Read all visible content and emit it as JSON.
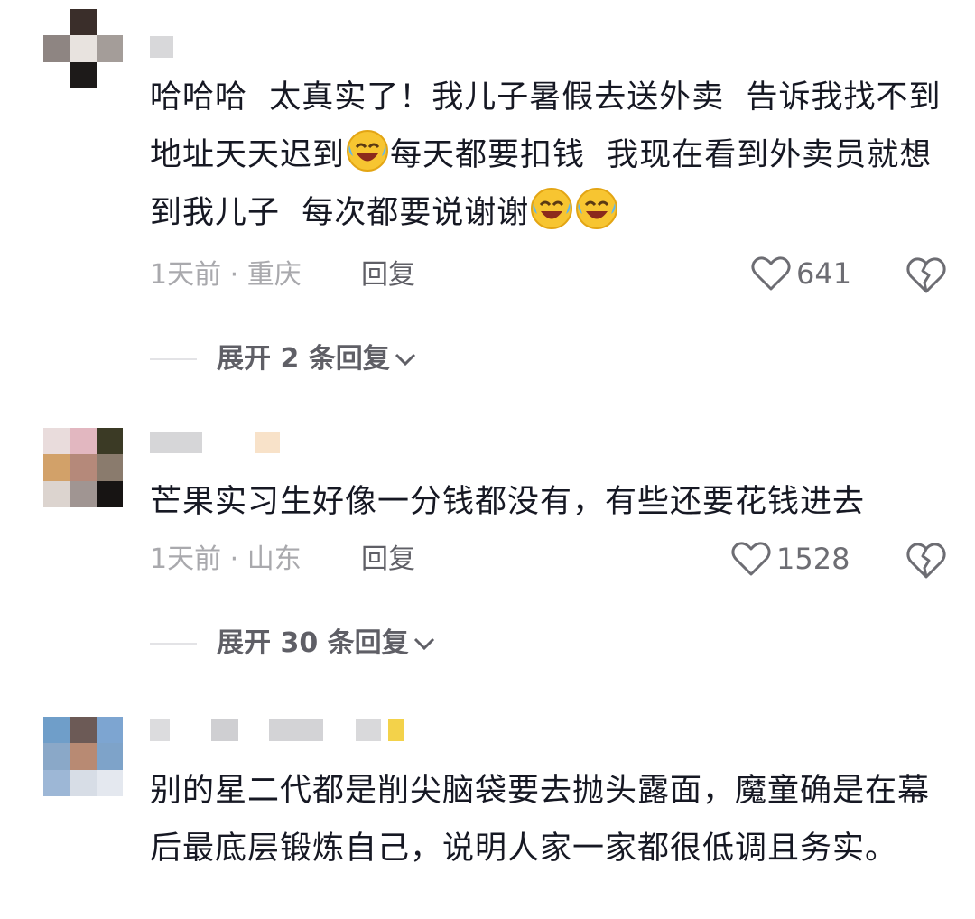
{
  "comments": [
    {
      "text_parts": [
        "哈哈哈  太真实了！我儿子暑假去送外卖  告诉我找不到地址天天迟到",
        "每天都要扣钱  我现在看到外卖员就想到我儿子  每次都要说谢谢"
      ],
      "emojis": [
        "laughing-crying-emoji"
      ],
      "meta": "1天前 · 重庆",
      "reply_label": "回复",
      "likes": "641",
      "expand_label": "展开 2 条回复"
    },
    {
      "text": "芒果实习生好像一分钱都没有，有些还要花钱进去",
      "meta": "1天前 · 山东",
      "reply_label": "回复",
      "likes": "1528",
      "expand_label": "展开 30 条回复"
    },
    {
      "text": "别的星二代都是削尖脑袋要去抛头露面，魔童确是在幕后最底层锻炼自己，说明人家一家都很低调且务实。"
    }
  ],
  "icons": {
    "like": "heart-outline-icon",
    "dislike": "broken-heart-icon",
    "expand": "chevron-down-icon"
  },
  "colors": {
    "text": "#161823",
    "meta": "#a9a9ad",
    "secondary": "#5f5f66",
    "emoji_face": "#f7c531"
  }
}
